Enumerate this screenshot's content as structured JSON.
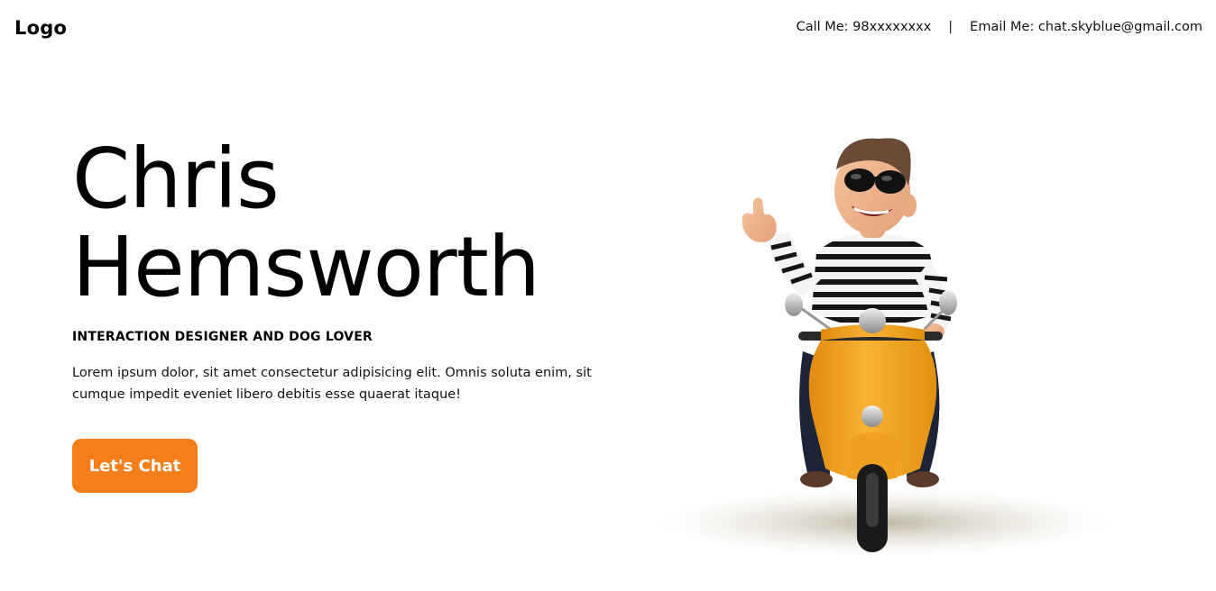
{
  "header": {
    "logo": "Logo",
    "phone": "Call Me: 98xxxxxxxx",
    "separator": "|",
    "email": "Email Me: chat.skyblue@gmail.com"
  },
  "hero": {
    "name_line1": "Chris",
    "name_line2": "Hemsworth",
    "tagline": "INTERACTION DESIGNER AND DOG LOVER",
    "description": "Lorem ipsum dolor, sit amet consectetur adipisicing elit. Omnis soluta enim, sit cumque impedit eveniet libero debitis esse quaerat itaque!",
    "cta_label": "Let's Chat"
  },
  "illustration": {
    "icon": "scooter-rider-illustration"
  },
  "colors": {
    "accent": "#f47f1a",
    "scooter": "#f5a623",
    "text": "#111111",
    "background": "#ffffff"
  }
}
